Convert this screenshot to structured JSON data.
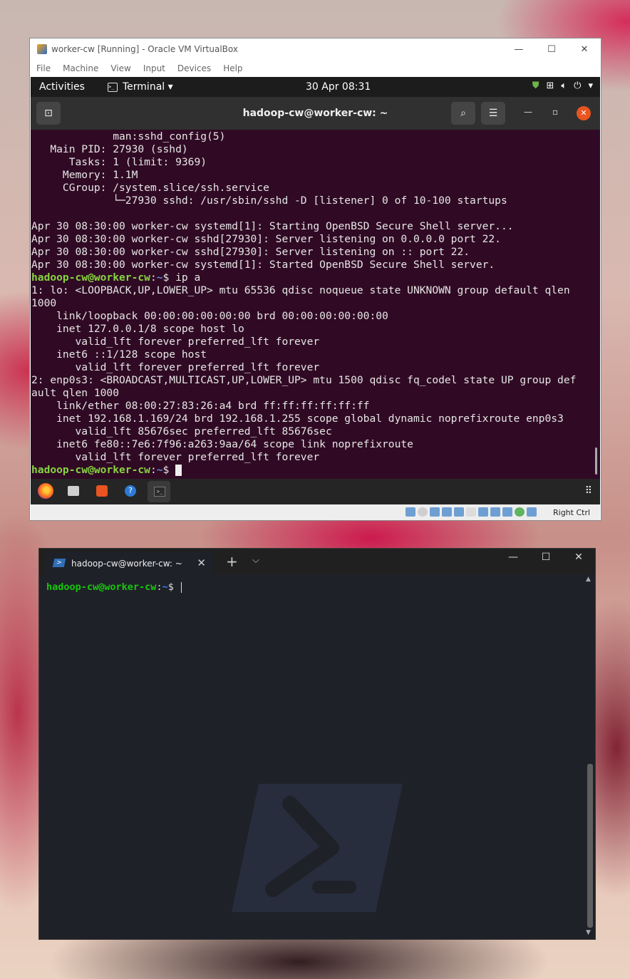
{
  "vbox": {
    "title": "worker-cw [Running] - Oracle VM VirtualBox",
    "menu": [
      "File",
      "Machine",
      "View",
      "Input",
      "Devices",
      "Help"
    ],
    "host_key": "Right Ctrl"
  },
  "gnome": {
    "activities": "Activities",
    "app_menu": "Terminal ▾",
    "clock": "30 Apr  08:31"
  },
  "ubuntu_terminal": {
    "title": "hadoop-cw@worker-cw: ~",
    "lines": [
      "             man:sshd_config(5)",
      "   Main PID: 27930 (sshd)",
      "      Tasks: 1 (limit: 9369)",
      "     Memory: 1.1M",
      "     CGroup: /system.slice/ssh.service",
      "             └─27930 sshd: /usr/sbin/sshd -D [listener] 0 of 10-100 startups",
      "",
      "Apr 30 08:30:00 worker-cw systemd[1]: Starting OpenBSD Secure Shell server...",
      "Apr 30 08:30:00 worker-cw sshd[27930]: Server listening on 0.0.0.0 port 22.",
      "Apr 30 08:30:00 worker-cw sshd[27930]: Server listening on :: port 22.",
      "Apr 30 08:30:00 worker-cw systemd[1]: Started OpenBSD Secure Shell server."
    ],
    "prompt_user": "hadoop-cw@worker-cw",
    "prompt_path": "~",
    "prompt_symbol": "$",
    "command": "ip a",
    "output": [
      "1: lo: <LOOPBACK,UP,LOWER_UP> mtu 65536 qdisc noqueue state UNKNOWN group default qlen",
      "1000",
      "    link/loopback 00:00:00:00:00:00 brd 00:00:00:00:00:00",
      "    inet 127.0.0.1/8 scope host lo",
      "       valid_lft forever preferred_lft forever",
      "    inet6 ::1/128 scope host",
      "       valid_lft forever preferred_lft forever",
      "2: enp0s3: <BROADCAST,MULTICAST,UP,LOWER_UP> mtu 1500 qdisc fq_codel state UP group def",
      "ault qlen 1000",
      "    link/ether 08:00:27:83:26:a4 brd ff:ff:ff:ff:ff:ff",
      "    inet 192.168.1.169/24 brd 192.168.1.255 scope global dynamic noprefixroute enp0s3",
      "       valid_lft 85676sec preferred_lft 85676sec",
      "    inet6 fe80::7e6:7f96:a263:9aa/64 scope link noprefixroute",
      "       valid_lft forever preferred_lft forever"
    ]
  },
  "windows_terminal": {
    "tab_title": "hadoop-cw@worker-cw: ~",
    "prompt_user": "hadoop-cw@worker-cw",
    "prompt_path": "~",
    "prompt_symbol": "$"
  },
  "icons": {
    "firefox": "firefox-icon",
    "files": "files-icon",
    "software": "software-icon",
    "help": "help-icon",
    "terminal": "terminal-icon"
  }
}
